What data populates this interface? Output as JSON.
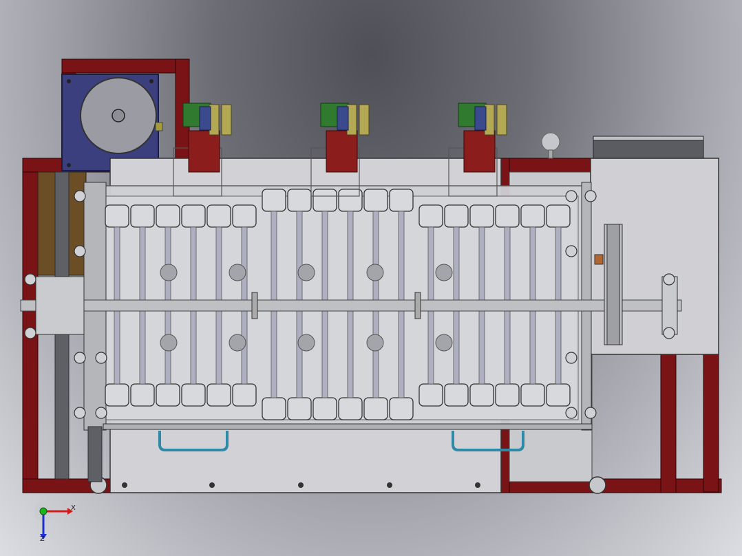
{
  "viewport": {
    "background_top": "#4f5057",
    "background_bottom": "#dcdde2"
  },
  "model": {
    "frame_color": "#7a1316",
    "motor_plate_color": "#3b3f7e",
    "housing_color": "#d2d2d6",
    "valve_color": "#8c1d1d",
    "connector_color": "#2f7a2f",
    "hose_color": "#2e8aa6",
    "shaft_color": "#bfc0c4",
    "roller_count_top": 18,
    "roller_count_bottom": 18,
    "valve_block_count": 3
  },
  "axis_triad": {
    "x_label": "X",
    "z_label": "Z",
    "x_color": "#d11c1c",
    "y_color": "#1db51d",
    "z_color": "#1c2fd1"
  }
}
